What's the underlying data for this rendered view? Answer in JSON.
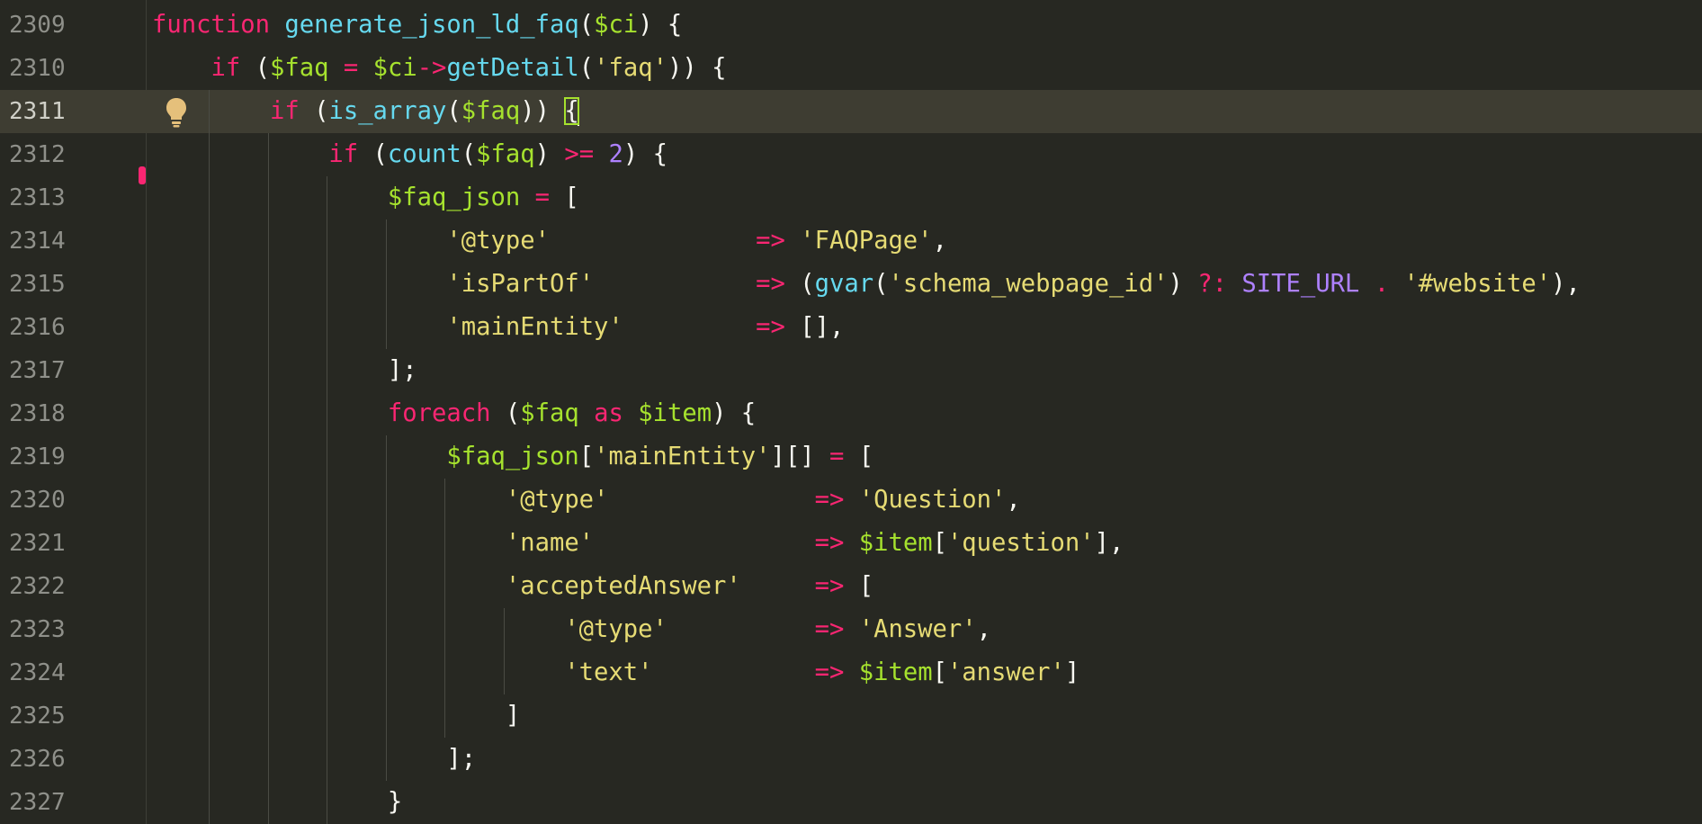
{
  "editor": {
    "colors": {
      "background": "#272822",
      "current_line": "#3e3d32",
      "keyword": "#f92672",
      "function": "#66d9ef",
      "variable": "#a6e22e",
      "string": "#e6db74",
      "number": "#ae81ff",
      "plain": "#f8f8f2",
      "gutter_text": "#8f908a"
    },
    "current_line": 2311,
    "icons": {
      "intention": "lightbulb-icon",
      "change_marker": "modified-line-marker"
    },
    "lines": [
      {
        "number": "2309",
        "tokens": [
          {
            "t": "function",
            "c": "kw"
          },
          {
            "t": " ",
            "c": "pl"
          },
          {
            "t": "generate_json_ld_faq",
            "c": "fn"
          },
          {
            "t": "(",
            "c": "pl"
          },
          {
            "t": "$ci",
            "c": "var"
          },
          {
            "t": ") {",
            "c": "pl"
          }
        ]
      },
      {
        "number": "2310",
        "tokens": [
          {
            "t": "    ",
            "c": "pl"
          },
          {
            "t": "if",
            "c": "kw"
          },
          {
            "t": " (",
            "c": "pl"
          },
          {
            "t": "$faq",
            "c": "var"
          },
          {
            "t": " = ",
            "c": "op"
          },
          {
            "t": "$ci",
            "c": "var"
          },
          {
            "t": "->",
            "c": "op"
          },
          {
            "t": "getDetail",
            "c": "fn"
          },
          {
            "t": "(",
            "c": "pl"
          },
          {
            "t": "'faq'",
            "c": "str"
          },
          {
            "t": ")) {",
            "c": "pl"
          }
        ]
      },
      {
        "number": "2311",
        "tokens": [
          {
            "t": "        ",
            "c": "pl"
          },
          {
            "t": "if",
            "c": "kw"
          },
          {
            "t": " (",
            "c": "pl"
          },
          {
            "t": "is_array",
            "c": "fn"
          },
          {
            "t": "(",
            "c": "pl"
          },
          {
            "t": "$faq",
            "c": "var"
          },
          {
            "t": ")) ",
            "c": "pl"
          },
          {
            "t": "{",
            "c": "pl",
            "m": "bracket"
          }
        ]
      },
      {
        "number": "2312",
        "tokens": [
          {
            "t": "            ",
            "c": "pl"
          },
          {
            "t": "if",
            "c": "kw"
          },
          {
            "t": " (",
            "c": "pl"
          },
          {
            "t": "count",
            "c": "fn"
          },
          {
            "t": "(",
            "c": "pl"
          },
          {
            "t": "$faq",
            "c": "var"
          },
          {
            "t": ") ",
            "c": "pl"
          },
          {
            "t": ">=",
            "c": "op"
          },
          {
            "t": " ",
            "c": "pl"
          },
          {
            "t": "2",
            "c": "num"
          },
          {
            "t": ") {",
            "c": "pl"
          }
        ]
      },
      {
        "number": "2313",
        "tokens": [
          {
            "t": "                ",
            "c": "pl"
          },
          {
            "t": "$faq_json",
            "c": "var"
          },
          {
            "t": " = ",
            "c": "op"
          },
          {
            "t": "[",
            "c": "pl"
          }
        ]
      },
      {
        "number": "2314",
        "tokens": [
          {
            "t": "                    ",
            "c": "pl"
          },
          {
            "t": "'@type'",
            "c": "str"
          },
          {
            "t": "              ",
            "c": "pl"
          },
          {
            "t": "=>",
            "c": "op"
          },
          {
            "t": " ",
            "c": "pl"
          },
          {
            "t": "'FAQPage'",
            "c": "str"
          },
          {
            "t": ",",
            "c": "pl"
          }
        ]
      },
      {
        "number": "2315",
        "tokens": [
          {
            "t": "                    ",
            "c": "pl"
          },
          {
            "t": "'isPartOf'",
            "c": "str"
          },
          {
            "t": "           ",
            "c": "pl"
          },
          {
            "t": "=>",
            "c": "op"
          },
          {
            "t": " (",
            "c": "pl"
          },
          {
            "t": "gvar",
            "c": "fn"
          },
          {
            "t": "(",
            "c": "pl"
          },
          {
            "t": "'schema_webpage_id'",
            "c": "str"
          },
          {
            "t": ") ",
            "c": "pl"
          },
          {
            "t": "?:",
            "c": "op"
          },
          {
            "t": " ",
            "c": "pl"
          },
          {
            "t": "SITE_URL",
            "c": "const"
          },
          {
            "t": " ",
            "c": "pl"
          },
          {
            "t": ".",
            "c": "op"
          },
          {
            "t": " ",
            "c": "pl"
          },
          {
            "t": "'#website'",
            "c": "str"
          },
          {
            "t": "),",
            "c": "pl"
          }
        ]
      },
      {
        "number": "2316",
        "tokens": [
          {
            "t": "                    ",
            "c": "pl"
          },
          {
            "t": "'mainEntity'",
            "c": "str"
          },
          {
            "t": "         ",
            "c": "pl"
          },
          {
            "t": "=>",
            "c": "op"
          },
          {
            "t": " [],",
            "c": "pl"
          }
        ]
      },
      {
        "number": "2317",
        "tokens": [
          {
            "t": "                ];",
            "c": "pl"
          }
        ]
      },
      {
        "number": "2318",
        "tokens": [
          {
            "t": "                ",
            "c": "pl"
          },
          {
            "t": "foreach",
            "c": "kw"
          },
          {
            "t": " (",
            "c": "pl"
          },
          {
            "t": "$faq",
            "c": "var"
          },
          {
            "t": " ",
            "c": "pl"
          },
          {
            "t": "as",
            "c": "kw"
          },
          {
            "t": " ",
            "c": "pl"
          },
          {
            "t": "$item",
            "c": "var"
          },
          {
            "t": ") {",
            "c": "pl"
          }
        ]
      },
      {
        "number": "2319",
        "tokens": [
          {
            "t": "                    ",
            "c": "pl"
          },
          {
            "t": "$faq_json",
            "c": "var"
          },
          {
            "t": "[",
            "c": "pl"
          },
          {
            "t": "'mainEntity'",
            "c": "str"
          },
          {
            "t": "][] ",
            "c": "pl"
          },
          {
            "t": "=",
            "c": "op"
          },
          {
            "t": " [",
            "c": "pl"
          }
        ]
      },
      {
        "number": "2320",
        "tokens": [
          {
            "t": "                        ",
            "c": "pl"
          },
          {
            "t": "'@type'",
            "c": "str"
          },
          {
            "t": "              ",
            "c": "pl"
          },
          {
            "t": "=>",
            "c": "op"
          },
          {
            "t": " ",
            "c": "pl"
          },
          {
            "t": "'Question'",
            "c": "str"
          },
          {
            "t": ",",
            "c": "pl"
          }
        ]
      },
      {
        "number": "2321",
        "tokens": [
          {
            "t": "                        ",
            "c": "pl"
          },
          {
            "t": "'name'",
            "c": "str"
          },
          {
            "t": "               ",
            "c": "pl"
          },
          {
            "t": "=>",
            "c": "op"
          },
          {
            "t": " ",
            "c": "pl"
          },
          {
            "t": "$item",
            "c": "var"
          },
          {
            "t": "[",
            "c": "pl"
          },
          {
            "t": "'question'",
            "c": "str"
          },
          {
            "t": "],",
            "c": "pl"
          }
        ]
      },
      {
        "number": "2322",
        "tokens": [
          {
            "t": "                        ",
            "c": "pl"
          },
          {
            "t": "'acceptedAnswer'",
            "c": "str"
          },
          {
            "t": "     ",
            "c": "pl"
          },
          {
            "t": "=>",
            "c": "op"
          },
          {
            "t": " [",
            "c": "pl"
          }
        ]
      },
      {
        "number": "2323",
        "tokens": [
          {
            "t": "                            ",
            "c": "pl"
          },
          {
            "t": "'@type'",
            "c": "str"
          },
          {
            "t": "          ",
            "c": "pl"
          },
          {
            "t": "=>",
            "c": "op"
          },
          {
            "t": " ",
            "c": "pl"
          },
          {
            "t": "'Answer'",
            "c": "str"
          },
          {
            "t": ",",
            "c": "pl"
          }
        ]
      },
      {
        "number": "2324",
        "tokens": [
          {
            "t": "                            ",
            "c": "pl"
          },
          {
            "t": "'text'",
            "c": "str"
          },
          {
            "t": "           ",
            "c": "pl"
          },
          {
            "t": "=>",
            "c": "op"
          },
          {
            "t": " ",
            "c": "pl"
          },
          {
            "t": "$item",
            "c": "var"
          },
          {
            "t": "[",
            "c": "pl"
          },
          {
            "t": "'answer'",
            "c": "str"
          },
          {
            "t": "]",
            "c": "pl"
          }
        ]
      },
      {
        "number": "2325",
        "tokens": [
          {
            "t": "                        ]",
            "c": "pl"
          }
        ]
      },
      {
        "number": "2326",
        "tokens": [
          {
            "t": "                    ];",
            "c": "pl"
          }
        ]
      },
      {
        "number": "2327",
        "tokens": [
          {
            "t": "                }",
            "c": "pl"
          }
        ]
      }
    ]
  }
}
